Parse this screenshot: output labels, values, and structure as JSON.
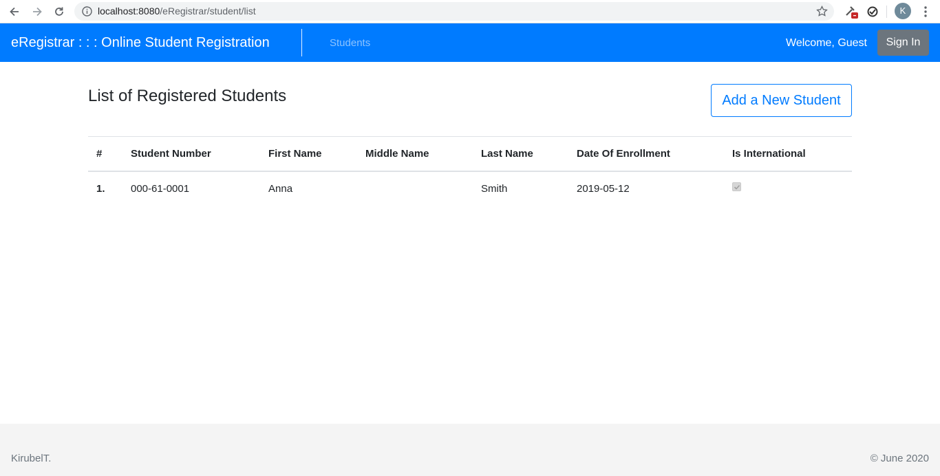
{
  "browser": {
    "url_host": "localhost:8080",
    "url_path": "/eRegistrar/student/list",
    "avatar_initial": "K",
    "icons": [
      "back-icon",
      "forward-icon",
      "reload-icon",
      "info-icon",
      "star-icon",
      "extension-icon",
      "sync-icon",
      "menu-dots-icon"
    ]
  },
  "navbar": {
    "brand": "eRegistrar : : : Online Student Registration",
    "link_students": "Students",
    "welcome": "Welcome, Guest",
    "sign_in": "Sign In",
    "color": "#007bff"
  },
  "main": {
    "title": "List of Registered Students",
    "add_button": "Add a New Student",
    "table": {
      "headers": [
        "#",
        "Student Number",
        "First Name",
        "Middle Name",
        "Last Name",
        "Date Of Enrollment",
        "Is International"
      ],
      "rows": [
        {
          "index": "1.",
          "student_number": "000-61-0001",
          "first_name": "Anna",
          "middle_name": "",
          "last_name": "Smith",
          "date_of_enrollment": "2019-05-12",
          "is_international": true
        }
      ]
    }
  },
  "footer": {
    "left": "KirubelT.",
    "right": "© June 2020"
  }
}
